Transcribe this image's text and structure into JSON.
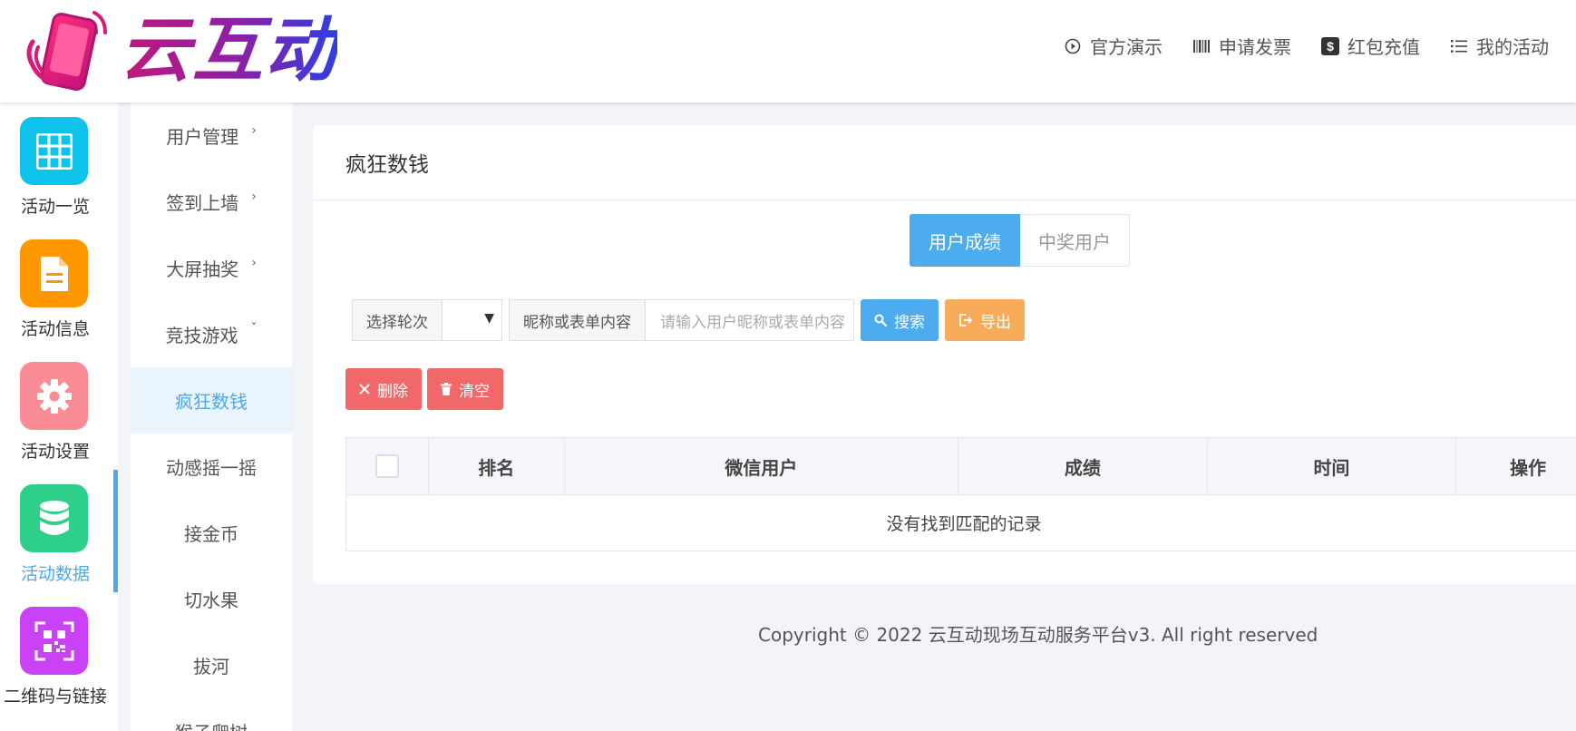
{
  "brand": {
    "name": "云互动"
  },
  "top_nav": [
    {
      "label": "官方演示",
      "icon": "play-circle-icon"
    },
    {
      "label": "申请发票",
      "icon": "barcode-icon"
    },
    {
      "label": "红包充值",
      "icon": "dollar-icon"
    },
    {
      "label": "我的活动",
      "icon": "list-icon"
    }
  ],
  "rail": [
    {
      "label": "活动一览",
      "icon": "grid-icon",
      "color": "#0ec3eb"
    },
    {
      "label": "活动信息",
      "icon": "document-icon",
      "color": "#ff9800"
    },
    {
      "label": "活动设置",
      "icon": "gear-icon",
      "color": "#f98c94"
    },
    {
      "label": "活动数据",
      "icon": "database-icon",
      "color": "#2ed089",
      "active": true
    },
    {
      "label": "二维码与链接",
      "icon": "qrcode-icon",
      "color": "#cb41f5"
    }
  ],
  "submenu": [
    {
      "label": "用户管理",
      "expandable": true,
      "chevron": "›"
    },
    {
      "label": "签到上墙",
      "expandable": true,
      "chevron": "›"
    },
    {
      "label": "大屏抽奖",
      "expandable": true,
      "chevron": "›"
    },
    {
      "label": "竞技游戏",
      "expandable": true,
      "chevron": "ˇ"
    },
    {
      "label": "疯狂数钱",
      "active": true
    },
    {
      "label": "动感摇一摇"
    },
    {
      "label": "接金币"
    },
    {
      "label": "切水果"
    },
    {
      "label": "拔河"
    },
    {
      "label": "猴子爬树"
    }
  ],
  "panel": {
    "title": "疯狂数钱",
    "tabs": [
      {
        "label": "用户成绩",
        "active": true
      },
      {
        "label": "中奖用户"
      }
    ],
    "filters": {
      "round_label": "选择轮次",
      "round_value": "",
      "search_label": "昵称或表单内容",
      "search_placeholder": "请输入用户昵称或表单内容"
    },
    "buttons": {
      "search": "搜索",
      "export": "导出",
      "delete": "删除",
      "clear": "清空"
    },
    "table": {
      "columns": [
        "排名",
        "微信用户",
        "成绩",
        "时间",
        "操作"
      ],
      "empty_text": "没有找到匹配的记录"
    }
  },
  "footer": {
    "copyright": "Copyright © 2022 云互动现场互动服务平台v3. All right reserved"
  },
  "colors": {
    "accent": "#4cacee",
    "warning": "#f8ac59",
    "danger": "#f16869"
  }
}
